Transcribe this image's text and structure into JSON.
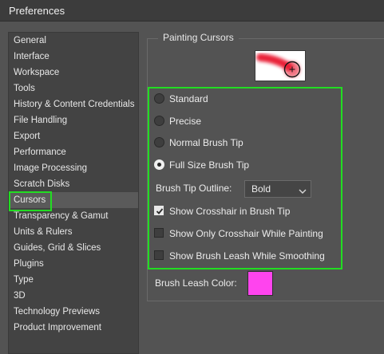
{
  "window": {
    "title": "Preferences"
  },
  "sidebar": {
    "items": [
      {
        "label": "General"
      },
      {
        "label": "Interface"
      },
      {
        "label": "Workspace"
      },
      {
        "label": "Tools"
      },
      {
        "label": "History & Content Credentials"
      },
      {
        "label": "File Handling"
      },
      {
        "label": "Export"
      },
      {
        "label": "Performance"
      },
      {
        "label": "Image Processing"
      },
      {
        "label": "Scratch Disks"
      },
      {
        "label": "Cursors"
      },
      {
        "label": "Transparency & Gamut"
      },
      {
        "label": "Units & Rulers"
      },
      {
        "label": "Guides, Grid & Slices"
      },
      {
        "label": "Plugins"
      },
      {
        "label": "Type"
      },
      {
        "label": "3D"
      },
      {
        "label": "Technology Previews"
      },
      {
        "label": "Product Improvement"
      }
    ],
    "selected": "Cursors"
  },
  "painting_cursors": {
    "title": "Painting Cursors",
    "options": [
      {
        "label": "Standard",
        "selected": false
      },
      {
        "label": "Precise",
        "selected": false
      },
      {
        "label": "Normal Brush Tip",
        "selected": false
      },
      {
        "label": "Full Size Brush Tip",
        "selected": true
      }
    ],
    "brush_tip_outline": {
      "label": "Brush Tip Outline:",
      "value": "Bold"
    },
    "checkboxes": [
      {
        "label": "Show Crosshair in Brush Tip",
        "checked": true
      },
      {
        "label": "Show Only Crosshair While Painting",
        "checked": false
      },
      {
        "label": "Show Brush Leash While Smoothing",
        "checked": false
      }
    ],
    "brush_leash_color": {
      "label": "Brush Leash Color:",
      "color": "#ff44ee"
    }
  },
  "colors": {
    "highlight": "#22dd22",
    "preview_stroke": "#e8122d"
  }
}
